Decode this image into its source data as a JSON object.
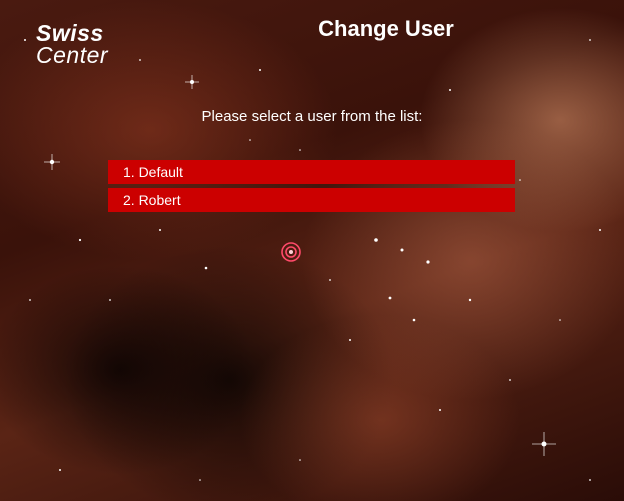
{
  "app": {
    "logo_line1": "Swiss",
    "logo_line2": "Center"
  },
  "page": {
    "title": "Change User",
    "prompt": "Please select a user from the list:"
  },
  "users": [
    {
      "label": "1. Default"
    },
    {
      "label": "2. Robert"
    }
  ],
  "colors": {
    "item_background": "#cc0000",
    "text": "#ffffff"
  }
}
